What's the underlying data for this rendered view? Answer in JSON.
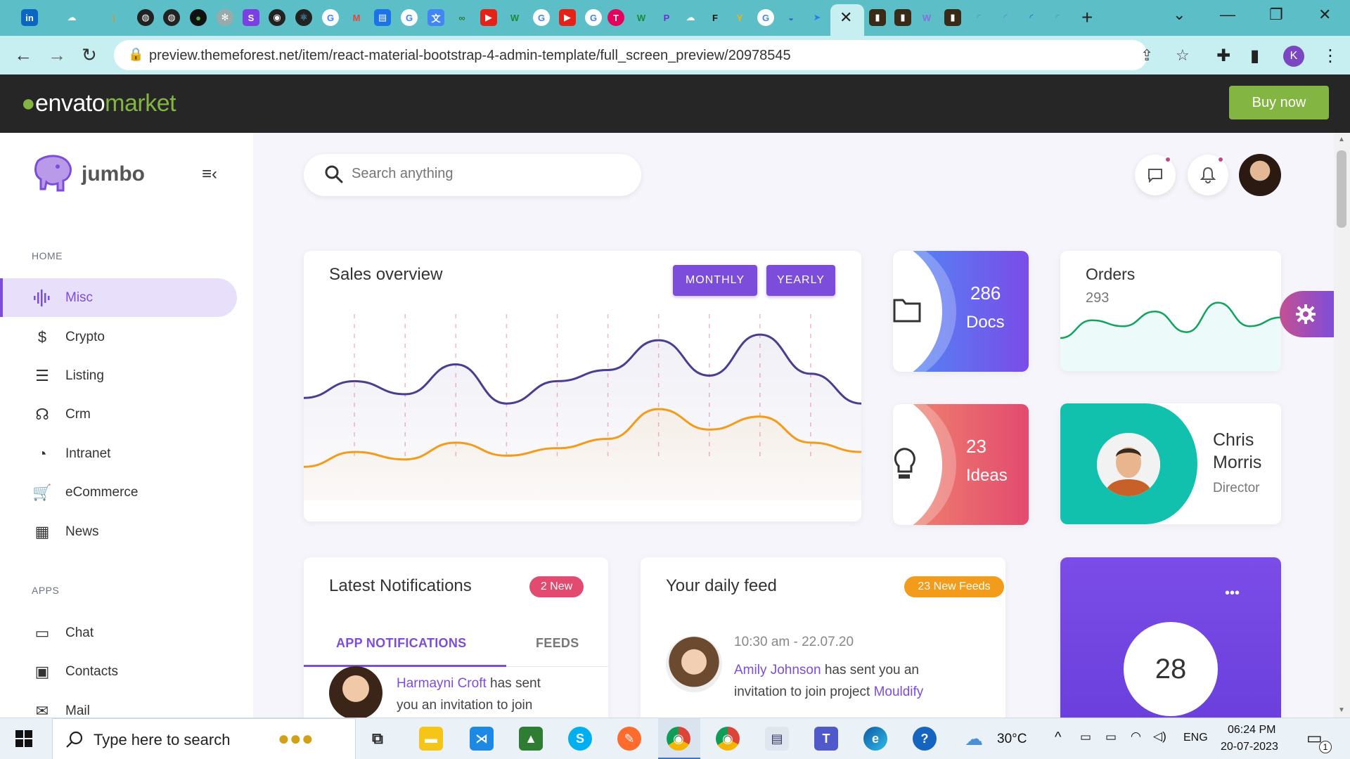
{
  "browser": {
    "url": "preview.themeforest.net/item/react-material-bootstrap-4-admin-template/full_screen_preview/20978545",
    "profile_initial": "K"
  },
  "envato": {
    "logo_main": "envato",
    "logo_sub": "market",
    "buy_label": "Buy now"
  },
  "sidebar": {
    "brand": "jumbo",
    "section_home": "HOME",
    "section_apps": "APPS",
    "home_items": [
      {
        "label": "Misc",
        "icon": "equalizer-icon"
      },
      {
        "label": "Crypto",
        "icon": "crypto-icon"
      },
      {
        "label": "Listing",
        "icon": "listing-icon"
      },
      {
        "label": "Crm",
        "icon": "headset-icon"
      },
      {
        "label": "Intranet",
        "icon": "pie-chart-icon"
      },
      {
        "label": "eCommerce",
        "icon": "cart-icon"
      },
      {
        "label": "News",
        "icon": "news-icon"
      }
    ],
    "app_items": [
      {
        "label": "Chat",
        "icon": "chat-icon"
      },
      {
        "label": "Contacts",
        "icon": "contacts-icon"
      },
      {
        "label": "Mail",
        "icon": "mail-icon"
      }
    ]
  },
  "header": {
    "search_placeholder": "Search anything"
  },
  "sales": {
    "title": "Sales overview",
    "monthly": "MONTHLY",
    "yearly": "YEARLY"
  },
  "chart_data": {
    "type": "area",
    "title": "Sales overview",
    "series": [
      {
        "color": "#4b3d8f",
        "values": [
          55,
          64,
          57,
          73,
          52,
          64,
          70,
          86,
          67,
          89,
          68,
          52
        ]
      },
      {
        "color": "#f39b1a",
        "values": [
          18,
          26,
          22,
          31,
          24,
          28,
          33,
          49,
          38,
          45,
          31,
          26
        ]
      }
    ],
    "ylim": [
      0,
      100
    ],
    "grid": true
  },
  "stats": {
    "docs_count": "286",
    "docs_label": "Docs",
    "ideas_count": "23",
    "ideas_label": "Ideas"
  },
  "orders": {
    "title": "Orders",
    "count": "293",
    "trend": [
      10,
      22,
      18,
      28,
      14,
      34,
      18,
      24
    ]
  },
  "person": {
    "first": "Chris",
    "last": "Morris",
    "role": "Director"
  },
  "notifications": {
    "title": "Latest Notifications",
    "badge": "2 New",
    "tab_app": "APP NOTIFICATIONS",
    "tab_feeds": "FEEDS",
    "item_name": "Harmayni Croft",
    "item_text": "has sent",
    "item_text2": "you an invitation to join"
  },
  "feed": {
    "title": "Your daily feed",
    "badge": "23 New Feeds",
    "time": "10:30 am - 22.07.20",
    "name": "Amily Johnson",
    "text1": "has sent you an",
    "text2": "invitation to join project",
    "project": "Mouldify"
  },
  "purple": {
    "menu": "•••",
    "value": "28"
  },
  "taskbar": {
    "search": "Type here to search",
    "weather": "30°C",
    "lang": "ENG",
    "time": "06:24 PM",
    "date": "20-07-2023",
    "notif_count": "1"
  },
  "colors": {
    "accent": "#7c4ddb",
    "teal": "#12c0ae",
    "orange": "#f39b1a",
    "pink": "#e34a6f",
    "envato_green": "#82b541"
  }
}
